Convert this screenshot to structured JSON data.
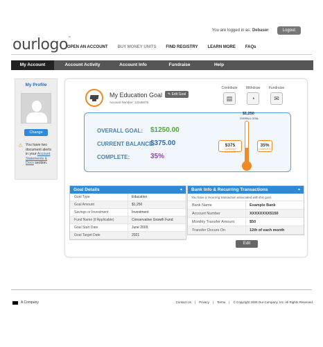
{
  "header": {
    "login_text": "You are logged in as:",
    "username": "Debaser",
    "logout_label": "Logout",
    "logo_text": "ourlogo",
    "logo_tm": "™"
  },
  "topnav": [
    "OPEN AN ACCOUNT",
    "BUY MONEY UNITS",
    "FIND REGISTRY",
    "LEARN MORE",
    "FAQs"
  ],
  "mainnav": [
    "My Account",
    "Account Activity",
    "Account Info",
    "Fundraise",
    "Help"
  ],
  "sidebar": {
    "title": "My Profile",
    "change_label": "Change",
    "alert_text": "You have two document alerts in your",
    "alert_link": "Account Statements & Docs",
    "alert_suffix": "section."
  },
  "goal": {
    "title": "My Education Goal",
    "account_number": "Account Number: 12345678",
    "edit_label": "Edit Goal",
    "actions": [
      {
        "label": "Contribute",
        "icon": "contribute-icon"
      },
      {
        "label": "Withdraw",
        "icon": "withdraw-icon"
      },
      {
        "label": "Fundraise",
        "icon": "fundraise-icon"
      }
    ],
    "overall_label": "OVERALL GOAL:",
    "overall_value": "$1250.00",
    "balance_label": "CURRENT BALANCE:",
    "balance_value": "$375.00",
    "complete_label": "COMPLETE:",
    "complete_value": "35%",
    "thermo_goal": "$1,250",
    "thermo_goal_label": "OVERALL GOAL",
    "thermo_balance": "$375",
    "thermo_balance_label": "CURRENT BALANCE",
    "thermo_percent": "35%",
    "thermo_percent_label": "COMPLETE",
    "progress_fraction": 0.35,
    "colors": {
      "accent": "#f08a24",
      "green": "#4fa92c",
      "blue": "#2a6db5",
      "purple": "#9a3ab5"
    }
  },
  "details": {
    "title": "Goal Details",
    "rows": [
      {
        "k": "Goal Type",
        "v": "Education"
      },
      {
        "k": "Goal Amount",
        "v": "$1,250"
      },
      {
        "k": "Savings or Investment",
        "v": "Investment"
      },
      {
        "k": "Fund Name (if Applicable)",
        "v": "Conservative Growth Fund"
      },
      {
        "k": "Goal Start Date",
        "v": "June 2009"
      },
      {
        "k": "Goal Target Date",
        "v": "2021"
      }
    ]
  },
  "bank": {
    "title": "Bank Info & Recurring Transactions",
    "note": "You have a recurring transaction associated with this goal.",
    "rows": [
      {
        "k": "Bank Name",
        "v": "Example Bank"
      },
      {
        "k": "Account Number",
        "v": "XXXXXXXX5150"
      },
      {
        "k": "Monthly Transfer Amount",
        "v": "$50"
      },
      {
        "k": "Transfer Occurs On",
        "v": "12th of each month"
      }
    ],
    "edit_label": "Edit"
  },
  "footer": {
    "company": "A Company",
    "links": [
      "Contact Us",
      "|",
      "Privacy",
      "|",
      "Terms",
      "|",
      "© Copyright 2009 Our Company, Inc. All Rights Reserved."
    ]
  }
}
